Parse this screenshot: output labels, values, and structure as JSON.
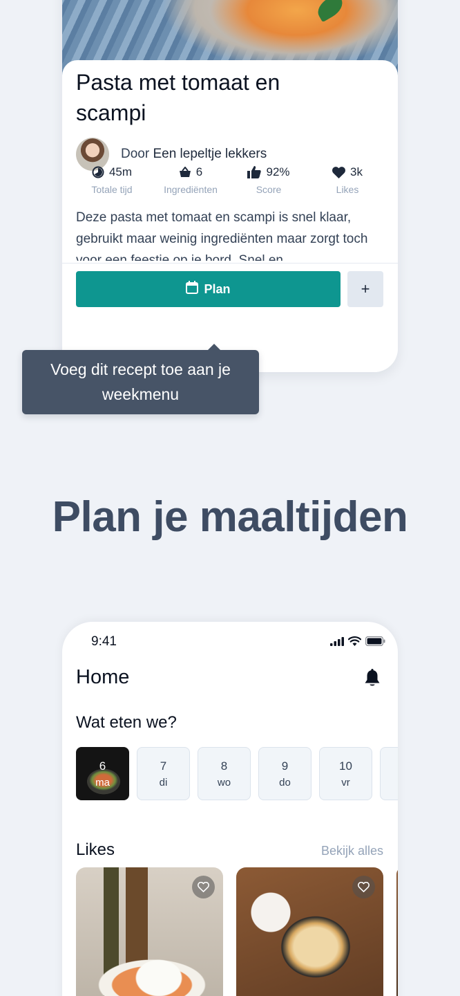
{
  "recipe": {
    "title": "Pasta met tomaat en scampi",
    "author_prefix": "Door",
    "author_name": "Een lepeltje lekkers",
    "stats": [
      {
        "icon": "clock-icon",
        "value": "45m",
        "label": "Totale tijd"
      },
      {
        "icon": "basket-icon",
        "value": "6",
        "label": "Ingrediënten"
      },
      {
        "icon": "thumbs-up-icon",
        "value": "92%",
        "label": "Score"
      },
      {
        "icon": "heart-icon",
        "value": "3k",
        "label": "Likes"
      }
    ],
    "description": "Deze pasta met tomaat en scampi is snel klaar, gebruikt maar weinig ingrediënten maar zorgt toch voor een feestje op je bord. Snel en",
    "plan_label": "Plan",
    "plus_label": "+"
  },
  "tooltip": "Voeg dit recept toe aan je weekmenu",
  "headline": "Plan je maaltijden",
  "home": {
    "status_time": "9:41",
    "title": "Home",
    "section_title": "Wat eten we?",
    "days": [
      {
        "num": "6",
        "weekday": "ma",
        "active": true
      },
      {
        "num": "7",
        "weekday": "di"
      },
      {
        "num": "8",
        "weekday": "wo"
      },
      {
        "num": "9",
        "weekday": "do"
      },
      {
        "num": "10",
        "weekday": "vr"
      }
    ],
    "likes_title": "Likes",
    "see_all": "Bekijk alles"
  },
  "colors": {
    "accent": "#0e9690",
    "background": "#eff2f7",
    "tooltip": "#475467",
    "headline": "#3e4c63"
  }
}
